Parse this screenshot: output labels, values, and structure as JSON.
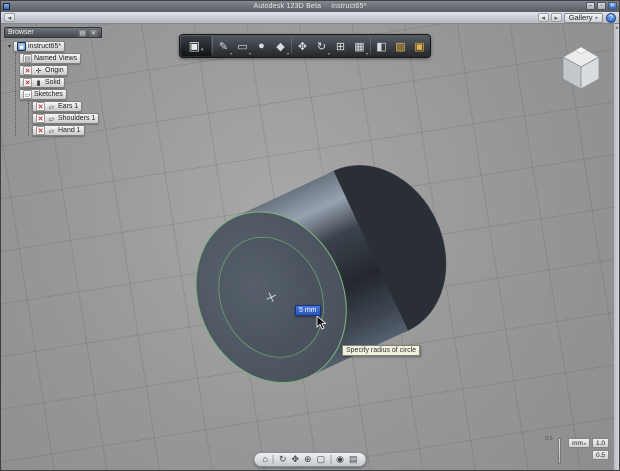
{
  "colors": {
    "accent_blue": "#2f62c8",
    "sketch_green": "#7fae7f",
    "toggle_red": "#c03030"
  },
  "title_bar": {
    "app_title": "Autodesk 123D Beta",
    "doc_title": "instruct65*",
    "minimize": "–",
    "maximize": "▫",
    "close": "✕"
  },
  "menu_bar": {
    "back": "◂",
    "forward": "▸",
    "gallery": "Gallery",
    "help": "?"
  },
  "browser": {
    "header": "Browser",
    "panel_menu": "▤",
    "panel_close": "✕",
    "expander": "▾",
    "items": [
      {
        "label": "instruct65*",
        "glyph": "▣"
      },
      {
        "label": "Named Views",
        "glyph": "▤"
      },
      {
        "label": "Origin",
        "glyph": "✛",
        "toggle": "✕"
      },
      {
        "label": "Solid",
        "glyph": "▮",
        "toggle": "✕"
      },
      {
        "label": "Sketches",
        "glyph": "▱"
      },
      {
        "label": "Ears 1",
        "glyph": "▱",
        "toggle": "✕"
      },
      {
        "label": "Shoulders 1",
        "glyph": "▱",
        "toggle": "✕"
      },
      {
        "label": "Hand 1",
        "glyph": "▱",
        "toggle": "✕"
      }
    ]
  },
  "toolbar": {
    "logo": "▣",
    "logo_caret": "▾",
    "items": [
      {
        "name": "sketch",
        "glyph": "✎"
      },
      {
        "name": "primitive-box",
        "glyph": "▭"
      },
      {
        "name": "primitive-sphere",
        "glyph": "●"
      },
      {
        "name": "extrude",
        "glyph": "◆"
      },
      {
        "name": "move",
        "glyph": "✥"
      },
      {
        "name": "revolve",
        "glyph": "↻"
      },
      {
        "name": "combine",
        "glyph": "⊞"
      },
      {
        "name": "pattern",
        "glyph": "▦"
      },
      {
        "name": "shell",
        "glyph": "◧"
      },
      {
        "name": "material",
        "glyph": "▨"
      },
      {
        "name": "snapshot",
        "glyph": "▣"
      }
    ]
  },
  "viewport": {
    "dimension_value": "5 mm",
    "tooltip": "Specify radius of circle"
  },
  "bottom_toolbar": {
    "items": [
      {
        "name": "home",
        "glyph": "⌂"
      },
      {
        "name": "orbit",
        "glyph": "↻"
      },
      {
        "name": "pan",
        "glyph": "✥"
      },
      {
        "name": "zoom",
        "glyph": "⊕"
      },
      {
        "name": "zoom-window",
        "glyph": "▢"
      },
      {
        "name": "look-at",
        "glyph": "◉"
      },
      {
        "name": "display-settings",
        "glyph": "▤"
      }
    ]
  },
  "scale_controls": {
    "ruler_tick": "0.5",
    "unit": "mm",
    "unit_caret": "▾",
    "grid_spacing": "1.0",
    "snap": "0.5"
  }
}
